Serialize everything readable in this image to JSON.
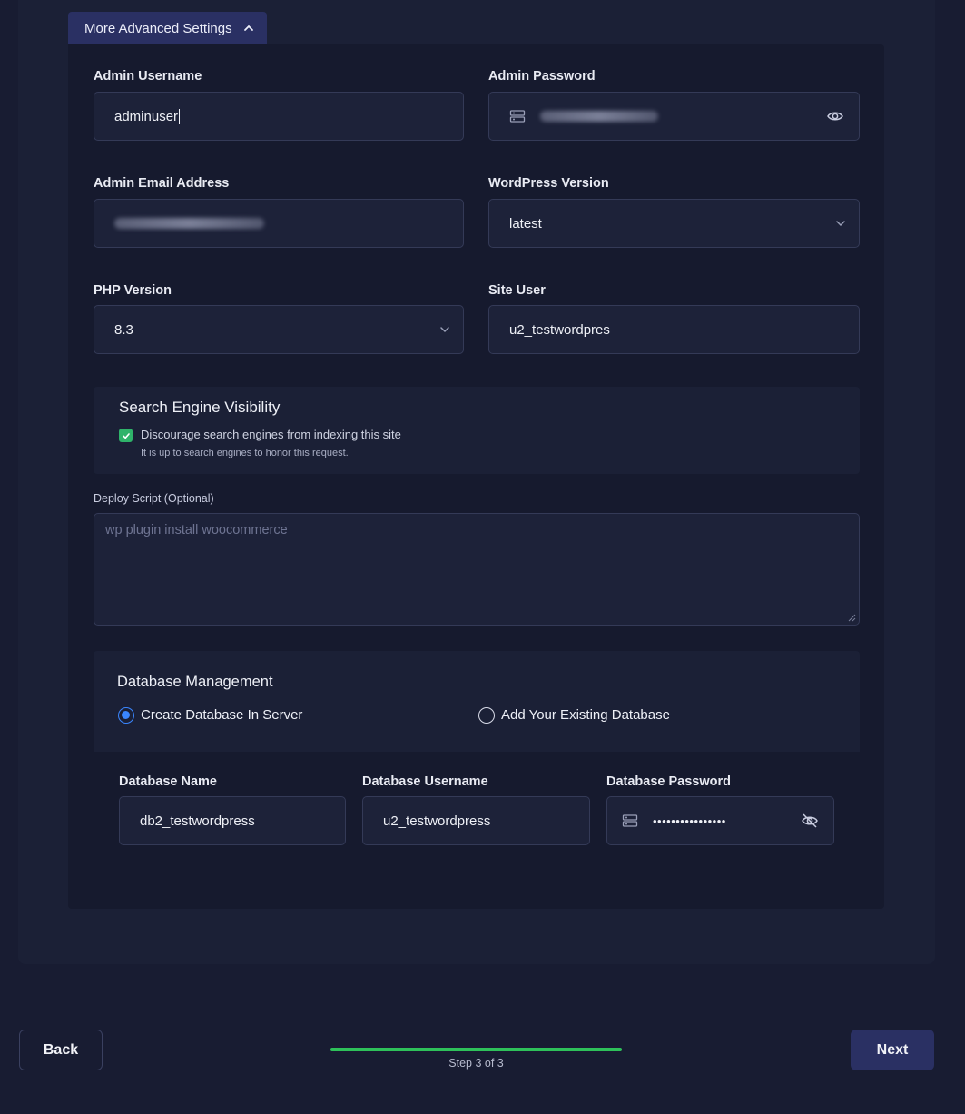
{
  "advanced_toggle": {
    "label": "More Advanced Settings",
    "icon": "chevron-up-icon"
  },
  "fields": {
    "admin_username": {
      "label": "Admin Username",
      "value": "adminuser"
    },
    "admin_password": {
      "label": "Admin Password",
      "value_hidden": true,
      "toggle_icon": "eye-icon"
    },
    "admin_email": {
      "label": "Admin Email Address",
      "value_hidden": true
    },
    "wp_version": {
      "label": "WordPress Version",
      "value": "latest"
    },
    "php_version": {
      "label": "PHP Version",
      "value": "8.3"
    },
    "site_user": {
      "label": "Site User",
      "value": "u2_testwordpres"
    }
  },
  "search_visibility": {
    "title": "Search Engine Visibility",
    "checkbox_label": "Discourage search engines from indexing this site",
    "checked": true,
    "help": "It is up to search engines to honor this request.",
    "check_color": "#2fb36a"
  },
  "deploy_script": {
    "label": "Deploy Script (Optional)",
    "placeholder": "wp plugin install woocommerce"
  },
  "database": {
    "title": "Database Management",
    "options": [
      {
        "label": "Create Database In Server",
        "selected": true
      },
      {
        "label": "Add Your Existing Database",
        "selected": false
      }
    ],
    "db_name": {
      "label": "Database Name",
      "value": "db2_testwordpress"
    },
    "db_username": {
      "label": "Database Username",
      "value": "u2_testwordpress"
    },
    "db_password": {
      "label": "Database Password",
      "value": "••••••••••••••••",
      "toggle_icon": "eye-off-icon"
    }
  },
  "footer": {
    "back_label": "Back",
    "next_label": "Next",
    "step_text": "Step 3 of 3",
    "progress": 1.0,
    "progress_color": "#2ec15a"
  }
}
